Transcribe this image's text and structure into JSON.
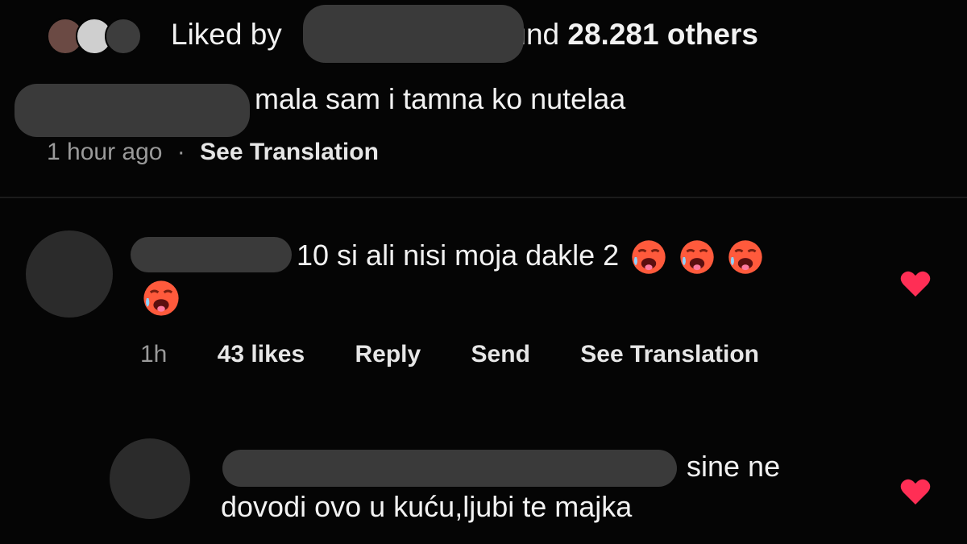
{
  "likes": {
    "prefix": "Liked by",
    "fragment": "und",
    "count_text": "28.281 others"
  },
  "caption": {
    "text": "mala sam i tamna ko nutelaa",
    "time": "1 hour ago",
    "separator": "·",
    "see_translation": "See Translation"
  },
  "comments": [
    {
      "text": "10 si ali nisi moja dakle 2",
      "time": "1h",
      "likes": "43 likes",
      "reply": "Reply",
      "send": "Send",
      "see_translation": "See Translation",
      "emoji": "hot-face-emoji",
      "liked": true
    },
    {
      "line1": "sine ne",
      "line2": "dovodi ovo u kuću,ljubi te majka",
      "liked": true
    }
  ],
  "colors": {
    "background": "#050505",
    "heart": "#ff2e55",
    "redaction": "#3a3a3a",
    "muted_text": "#9a9a9a"
  }
}
